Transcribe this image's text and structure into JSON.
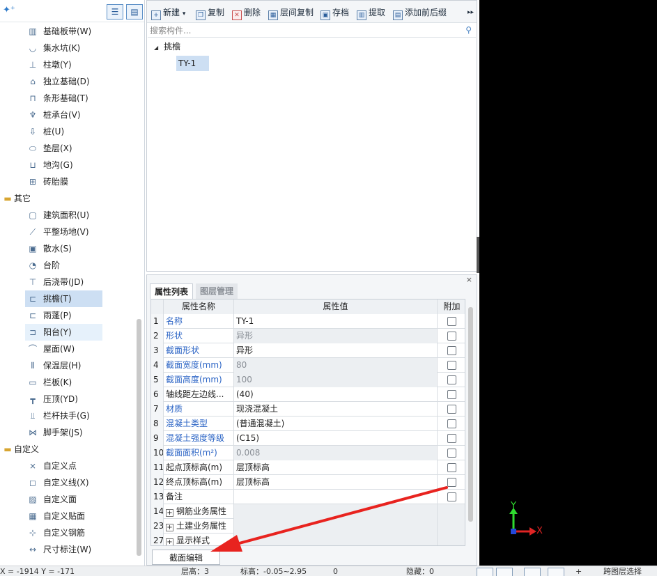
{
  "left_panel": {
    "toolbar": {
      "add_icon": "add-sparkle-icon",
      "view_list_icon": "list-view-icon",
      "view_grid_icon": "grid-view-icon"
    },
    "items": [
      {
        "label": "基础板带(W)",
        "icon": "foundation-strip-icon",
        "kind": "child"
      },
      {
        "label": "集水坑(K)",
        "icon": "sump-pit-icon",
        "kind": "child"
      },
      {
        "label": "柱墩(Y)",
        "icon": "column-pier-icon",
        "kind": "child"
      },
      {
        "label": "独立基础(D)",
        "icon": "isolated-footing-icon",
        "kind": "child"
      },
      {
        "label": "条形基础(T)",
        "icon": "strip-footing-icon",
        "kind": "child"
      },
      {
        "label": "桩承台(V)",
        "icon": "pile-cap-icon",
        "kind": "child"
      },
      {
        "label": "桩(U)",
        "icon": "pile-icon",
        "kind": "child"
      },
      {
        "label": "垫层(X)",
        "icon": "cushion-icon",
        "kind": "child"
      },
      {
        "label": "地沟(G)",
        "icon": "trench-icon",
        "kind": "child"
      },
      {
        "label": "砖胎膜",
        "icon": "brick-mold-icon",
        "kind": "child"
      },
      {
        "label": "其它",
        "icon": "folder-icon",
        "kind": "group"
      },
      {
        "label": "建筑面积(U)",
        "icon": "building-area-icon",
        "kind": "child"
      },
      {
        "label": "平整场地(V)",
        "icon": "site-leveling-icon",
        "kind": "child"
      },
      {
        "label": "散水(S)",
        "icon": "apron-icon",
        "kind": "child"
      },
      {
        "label": "台阶",
        "icon": "steps-icon",
        "kind": "child"
      },
      {
        "label": "后浇带(JD)",
        "icon": "post-cast-strip-icon",
        "kind": "child"
      },
      {
        "label": "挑檐(T)",
        "icon": "overhang-icon",
        "kind": "selected"
      },
      {
        "label": "雨蓬(P)",
        "icon": "canopy-icon",
        "kind": "child"
      },
      {
        "label": "阳台(Y)",
        "icon": "balcony-icon",
        "kind": "hover"
      },
      {
        "label": "屋面(W)",
        "icon": "roof-icon",
        "kind": "child"
      },
      {
        "label": "保温层(H)",
        "icon": "insulation-icon",
        "kind": "child"
      },
      {
        "label": "栏板(K)",
        "icon": "parapet-icon",
        "kind": "child"
      },
      {
        "label": "压顶(YD)",
        "icon": "coping-icon",
        "kind": "child"
      },
      {
        "label": "栏杆扶手(G)",
        "icon": "railing-icon",
        "kind": "child"
      },
      {
        "label": "脚手架(JS)",
        "icon": "scaffold-icon",
        "kind": "child"
      },
      {
        "label": "自定义",
        "icon": "folder-icon",
        "kind": "group"
      },
      {
        "label": "自定义点",
        "icon": "custom-point-icon",
        "kind": "child"
      },
      {
        "label": "自定义线(X)",
        "icon": "custom-line-icon",
        "kind": "child"
      },
      {
        "label": "自定义面",
        "icon": "custom-face-icon",
        "kind": "child"
      },
      {
        "label": "自定义贴面",
        "icon": "custom-facing-icon",
        "kind": "child"
      },
      {
        "label": "自定义钢筋",
        "icon": "custom-rebar-icon",
        "kind": "child"
      },
      {
        "label": "尺寸标注(W)",
        "icon": "dimension-icon",
        "kind": "child"
      }
    ]
  },
  "component_panel": {
    "toolbar": [
      {
        "label": "新建",
        "icon": "new-icon",
        "dropdown": "▾"
      },
      {
        "label": "复制",
        "icon": "copy-icon"
      },
      {
        "label": "删除",
        "icon": "delete-icon"
      },
      {
        "label": "层间复制",
        "icon": "floor-copy-icon"
      },
      {
        "label": "存档",
        "icon": "archive-icon"
      },
      {
        "label": "提取",
        "icon": "extract-icon"
      },
      {
        "label": "添加前后缀",
        "icon": "add-prefix-icon"
      }
    ],
    "more": "▸▸",
    "search": {
      "placeholder": "搜索构件..."
    },
    "tree": {
      "group_label": "挑檐",
      "item_label": "TY-1"
    }
  },
  "properties_panel": {
    "tabs": [
      "属性列表",
      "图层管理"
    ],
    "columns": {
      "name": "属性名称",
      "value": "属性值",
      "add": "附加"
    },
    "rows": [
      {
        "num": "1",
        "name": "名称",
        "value": "TY-1",
        "blue": true,
        "gray": false,
        "checkbox": true
      },
      {
        "num": "2",
        "name": "形状",
        "value": "异形",
        "blue": true,
        "gray": true,
        "checkbox": true
      },
      {
        "num": "3",
        "name": "截面形状",
        "value": "异形",
        "blue": true,
        "gray": false,
        "checkbox": true
      },
      {
        "num": "4",
        "name": "截面宽度(mm)",
        "value": "80",
        "blue": true,
        "gray": true,
        "checkbox": true
      },
      {
        "num": "5",
        "name": "截面高度(mm)",
        "value": "100",
        "blue": true,
        "gray": true,
        "checkbox": true
      },
      {
        "num": "6",
        "name": "轴线距左边线...",
        "value": "(40)",
        "blue": false,
        "gray": false,
        "checkbox": true
      },
      {
        "num": "7",
        "name": "材质",
        "value": "现浇混凝土",
        "blue": true,
        "gray": false,
        "checkbox": true
      },
      {
        "num": "8",
        "name": "混凝土类型",
        "value": "(普通混凝土)",
        "blue": true,
        "gray": false,
        "checkbox": true
      },
      {
        "num": "9",
        "name": "混凝土强度等级",
        "value": "(C15)",
        "blue": true,
        "gray": false,
        "checkbox": true
      },
      {
        "num": "10",
        "name": "截面面积(m²)",
        "value": "0.008",
        "blue": true,
        "gray": true,
        "checkbox": true
      },
      {
        "num": "11",
        "name": "起点顶标高(m)",
        "value": "层顶标高",
        "blue": false,
        "gray": false,
        "checkbox": true
      },
      {
        "num": "12",
        "name": "终点顶标高(m)",
        "value": "层顶标高",
        "blue": false,
        "gray": false,
        "checkbox": true
      },
      {
        "num": "13",
        "name": "备注",
        "value": "",
        "blue": false,
        "gray": false,
        "checkbox": true
      },
      {
        "num": "14",
        "name": "钢筋业务属性",
        "value": "",
        "blue": false,
        "gray": true,
        "checkbox": false,
        "expander": "+"
      },
      {
        "num": "23",
        "name": "土建业务属性",
        "value": "",
        "blue": false,
        "gray": true,
        "checkbox": false,
        "expander": "+"
      },
      {
        "num": "27",
        "name": "显示样式",
        "value": "",
        "blue": false,
        "gray": true,
        "checkbox": false,
        "expander": "+"
      }
    ],
    "close_icon": "×",
    "edit_button": "截面编辑"
  },
  "canvas": {
    "axis_y": "Y",
    "axis_x": "X",
    "colors": {
      "y_axis": "#2fdc2f",
      "x_axis": "#e02424",
      "origin": "#2348d8",
      "annotation_arrow": "#e8231f"
    }
  },
  "status_bar": {
    "coords": "X = -1914 Y = -171",
    "floor_height": "层高：3",
    "elevation": "标高：-0.05~2.95",
    "count": "0",
    "hidden": "隐藏：0",
    "plus": "+",
    "cross_layer": "跨图层选择"
  }
}
